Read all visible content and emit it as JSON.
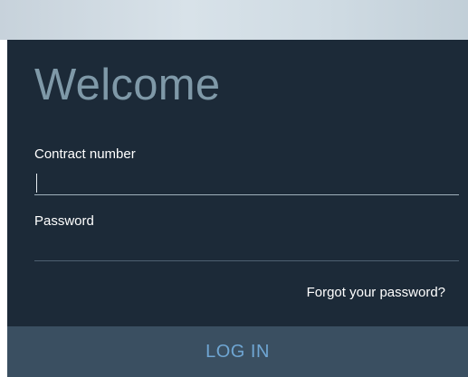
{
  "login": {
    "title": "Welcome",
    "contract_label": "Contract number",
    "contract_value": "",
    "password_label": "Password",
    "password_value": "",
    "forgot_link": "Forgot your password?",
    "login_button": "LOG IN"
  },
  "colors": {
    "panel_background": "#1c2a38",
    "title_text": "#7f99a8",
    "button_background": "#3a4f61",
    "button_text": "#6fa6d3"
  }
}
